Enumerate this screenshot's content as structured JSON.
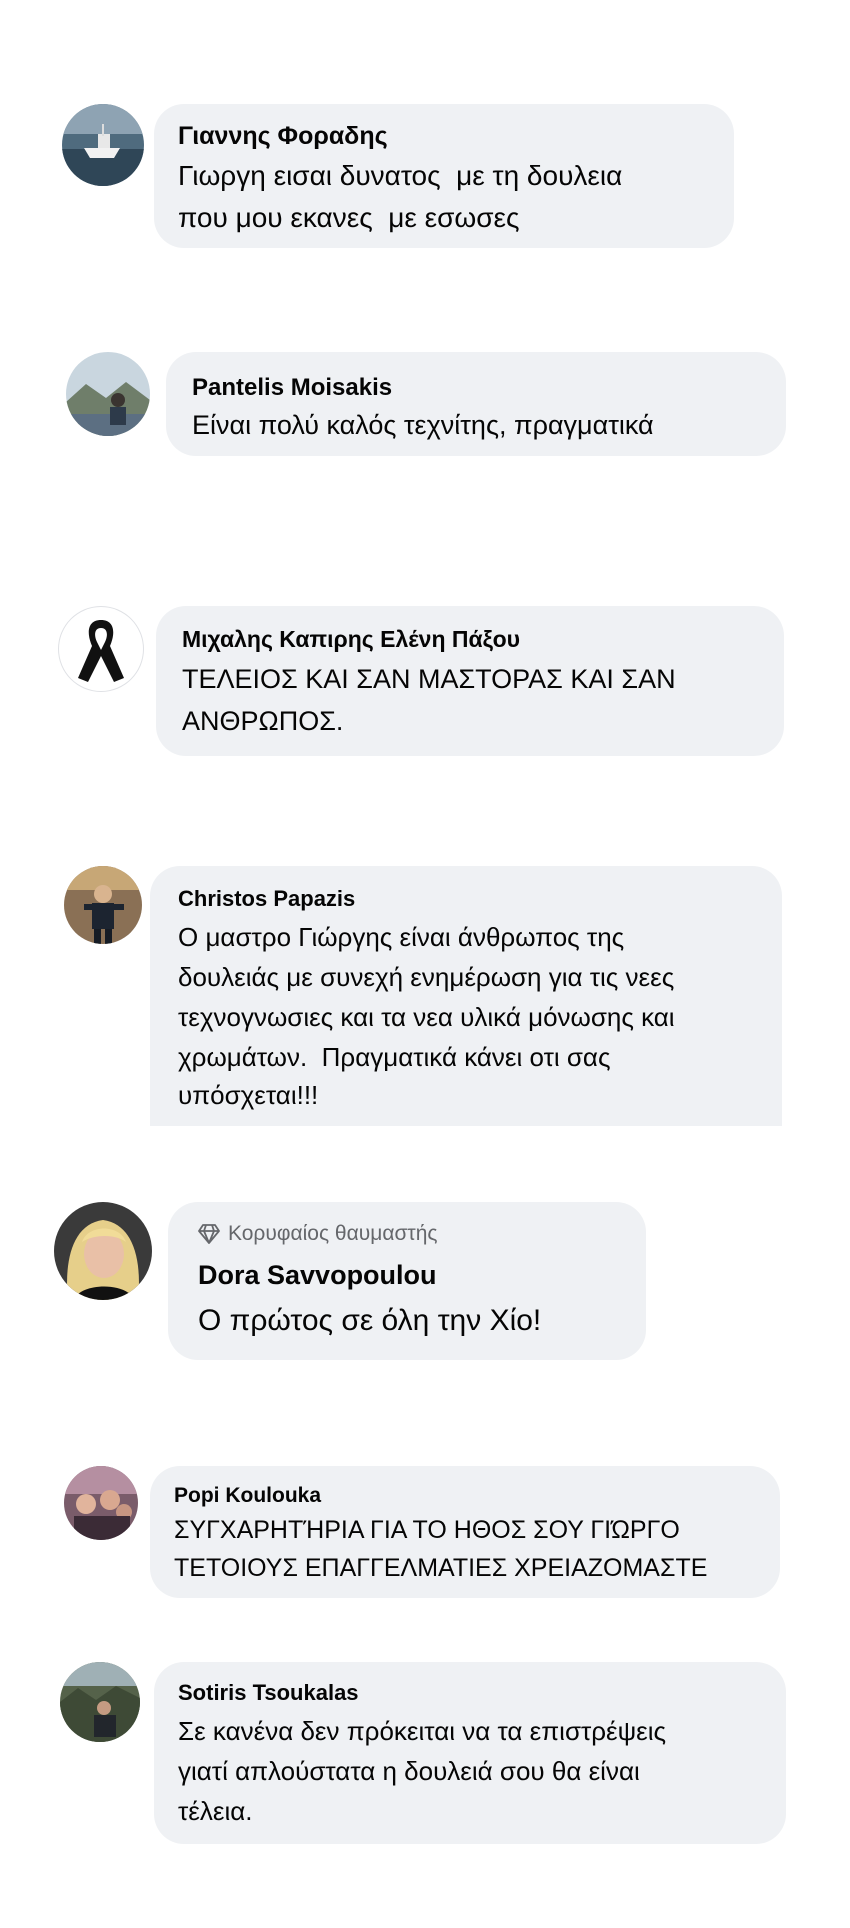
{
  "comments": [
    {
      "author": "Γιαννης Φοραδης",
      "lines": [
        "Γιωργη εισαι δυνατος  με τη δουλεια",
        "που μου εκανες  με εσωσες"
      ],
      "avatar_icon": "boat-photo-icon"
    },
    {
      "author": "Pantelis Moisakis",
      "lines": [
        "Είναι πολύ καλός τεχνίτης, πραγματικά"
      ],
      "avatar_icon": "landscape-photo-icon"
    },
    {
      "author": "Μιχαλης Καπιρης Ελένη Πάξου",
      "lines": [
        "ΤΕΛΕΙΟΣ ΚΑΙ ΣΑΝ ΜΑΣΤΟΡΑΣ ΚΑΙ ΣΑΝ",
        "ΑΝΘΡΩΠΟΣ."
      ],
      "avatar_icon": "black-ribbon-icon"
    },
    {
      "author": "Christos Papazis",
      "lines": [
        "Ο μαστρο Γιώργης είναι άνθρωπος της",
        "δουλειάς με συνεχή ενημέρωση για τις νεες",
        "τεχνογνωσιες και τα νεα υλικά μόνωσης και",
        "χρωμάτων.  Πραγματικά κάνει οτι σας",
        "υπόσχεται!!!"
      ],
      "avatar_icon": "person-photo-icon"
    },
    {
      "badge": "Κορυφαίος θαυμαστής",
      "badge_icon": "diamond-icon",
      "author": "Dora Savvopoulou",
      "lines": [
        "Ο πρώτος σε όλη την Χίο!"
      ],
      "avatar_icon": "portrait-photo-icon"
    },
    {
      "author": "Popi Koulouka",
      "lines": [
        "ΣΥΓΧΑΡΗΤΉΡΙΑ ΓΙΑ ΤΟ ΗΘΟΣ ΣΟΥ ΓΙΏΡΓΟ",
        "ΤΕΤΟΙΟΥΣ ΕΠΑΓΓΕΛΜΑΤΙΕΣ ΧΡΕΙΑΖΟΜΑΣΤΕ"
      ],
      "avatar_icon": "group-photo-icon"
    },
    {
      "author": "Sotiris Tsoukalas",
      "lines": [
        "Σε κανένα δεν πρόκειται να τα επιστρέψεις",
        "γιατί απλούστατα η δουλειά σου θα είναι",
        "τέλεια."
      ],
      "avatar_icon": "outdoor-photo-icon"
    }
  ]
}
